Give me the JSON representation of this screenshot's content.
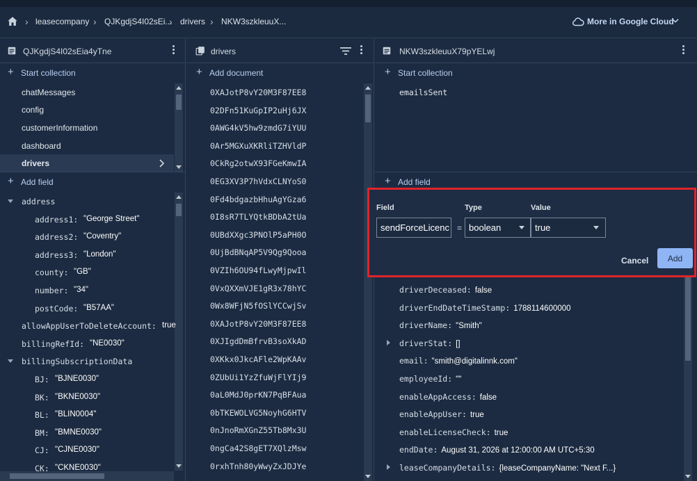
{
  "breadcrumb": [
    "leasecompany",
    "QJKgdjS4I02sEi...",
    "drivers",
    "NKW3szkleuuX..."
  ],
  "top_action": "More in Google Cloud",
  "left_panel": {
    "title": "QJKgdjS4I02sEia4yTne",
    "start_collection": "Start collection",
    "collections": [
      "chatMessages",
      "config",
      "customerInformation",
      "dashboard",
      "drivers"
    ],
    "add_field": "Add field",
    "fields": [
      {
        "key": "address",
        "value": "",
        "kind": "map-open"
      },
      {
        "key": "address1:",
        "value": "\"George Street\"",
        "kind": "child"
      },
      {
        "key": "address2:",
        "value": "\"Coventry\"",
        "kind": "child"
      },
      {
        "key": "address3:",
        "value": "\"London\"",
        "kind": "child"
      },
      {
        "key": "county:",
        "value": "\"GB\"",
        "kind": "child"
      },
      {
        "key": "number:",
        "value": "\"34\"",
        "kind": "child"
      },
      {
        "key": "postCode:",
        "value": "\"B57AA\"",
        "kind": "child"
      },
      {
        "key": "allowAppUserToDeleteAccount:",
        "value": "true",
        "kind": "top"
      },
      {
        "key": "billingRefId:",
        "value": "\"NE0030\"",
        "kind": "top"
      },
      {
        "key": "billingSubscriptionData",
        "value": "",
        "kind": "map-open"
      },
      {
        "key": "BJ:",
        "value": "\"BJNE0030\"",
        "kind": "child"
      },
      {
        "key": "BK:",
        "value": "\"BKNE0030\"",
        "kind": "child"
      },
      {
        "key": "BL:",
        "value": "\"BLIN0004\"",
        "kind": "child"
      },
      {
        "key": "BM:",
        "value": "\"BMNE0030\"",
        "kind": "child"
      },
      {
        "key": "CJ:",
        "value": "\"CJNE0030\"",
        "kind": "child"
      },
      {
        "key": "CK:",
        "value": "\"CKNE0030\"",
        "kind": "child"
      }
    ]
  },
  "mid_panel": {
    "title": "drivers",
    "add_document": "Add document",
    "documents": [
      "0XAJotP8vY20M3F87EE8",
      "02DFn51KuGpIP2uHj6JX",
      "0AWG4kV5hw9zmdG7iYUU",
      "0Ar5MGXuXKRliTZHVldP",
      "0CkRg2otwX93FGeKmwIA",
      "0EG3XV3P7hVdxCLNYoS0",
      "0Fd4bdgazbHhuAgYGza6",
      "0I8sR7TLYQtkBDbA2tUa",
      "0UBdXXgc3PNOlP5aPH0O",
      "0UjBdBNqAP5V9Qg9Qooa",
      "0VZIh6OU94fLwyMjpwIl",
      "0VxQXXmVJE1gR3x78hYC",
      "0Wx8WFjN5fOSlYCCwjSv",
      "0XAJotP8vY20M3F87EE8",
      "0XJIgdDmBfrvB3soXkAD",
      "0XKkx0JkcAFle2WpKAAv",
      "0ZUbUi1YzZfuWjFlYIj9",
      "0aL0MdJ0prKN7PqBFAua",
      "0bTKEWOLVG5NoyhG6HTV",
      "0nJnoRmXGnZ55Tb8Mx3U",
      "0ngCa42S8gET7XQlzMsw",
      "0rxhTnh80yWwyZxJDJYe"
    ]
  },
  "right_panel": {
    "title": "NKW3szkleuuX79pYELwj",
    "start_collection": "Start collection",
    "subcollections": [
      "emailsSent"
    ],
    "add_field": "Add field",
    "fields": [
      {
        "key": "driverDeceased:",
        "value": "false",
        "expandable": false
      },
      {
        "key": "driverEndDateTimeStamp:",
        "value": "1788114600000",
        "expandable": false
      },
      {
        "key": "driverName:",
        "value": "\"Smith\"",
        "expandable": false
      },
      {
        "key": "driverStat:",
        "value": "[]",
        "expandable": true
      },
      {
        "key": "email:",
        "value": "\"smith@digitalinnk.com\"",
        "expandable": false
      },
      {
        "key": "employeeId:",
        "value": "\"\"",
        "expandable": false
      },
      {
        "key": "enableAppAccess:",
        "value": "false",
        "expandable": false
      },
      {
        "key": "enableAppUser:",
        "value": "true",
        "expandable": false
      },
      {
        "key": "enableLicenseCheck:",
        "value": "true",
        "expandable": false
      },
      {
        "key": "endDate:",
        "value": "August 31, 2026 at 12:00:00 AM UTC+5:30",
        "expandable": false
      },
      {
        "key": "leaseCompanyDetails:",
        "value": "{leaseCompanyName: \"Next F...}",
        "expandable": true
      }
    ]
  },
  "add_field_dialog": {
    "field_label": "Field",
    "type_label": "Type",
    "value_label": "Value",
    "field_value": "sendForceLicenc",
    "equals": "=",
    "type_value": "boolean",
    "value_value": "true",
    "cancel_label": "Cancel",
    "add_label": "Add"
  },
  "colors": {
    "highlight_border": "#e0242b",
    "accent": "#8fb5f5",
    "link": "#b8cdf0"
  }
}
